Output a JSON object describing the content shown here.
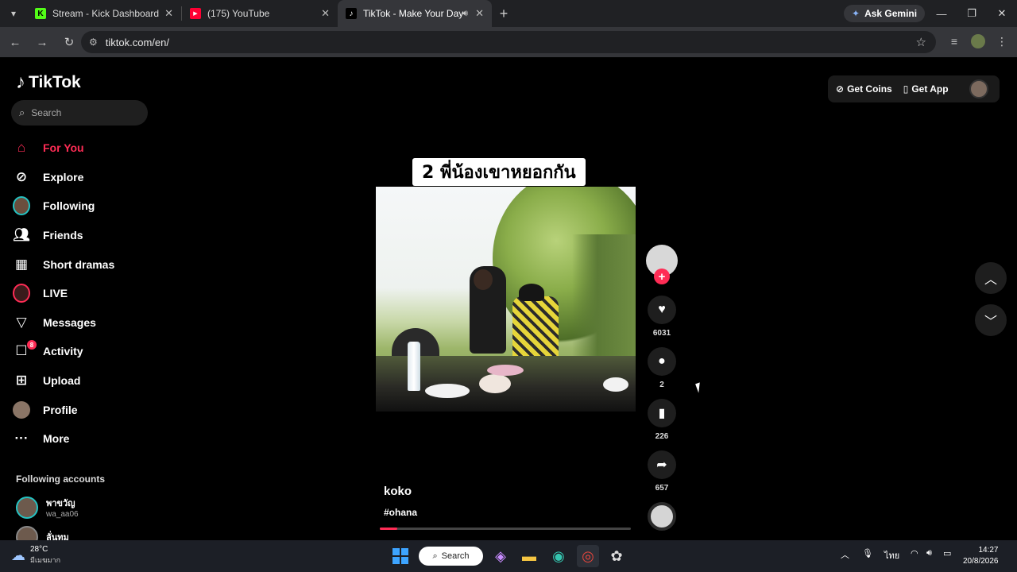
{
  "browser": {
    "tabs": [
      {
        "title": "Stream - Kick Dashboard",
        "favicon": "kick-icon",
        "color": "#53fc18"
      },
      {
        "title": "(175) YouTube",
        "favicon": "youtube-icon",
        "color": "#ff0033"
      },
      {
        "title": "TikTok - Make Your Day",
        "favicon": "tiktok-icon",
        "color": "#ffffff",
        "active": true
      }
    ],
    "ask_gemini": "Ask Gemini",
    "url": "tiktok.com/en/"
  },
  "tiktok": {
    "logo": "TikTok",
    "search_placeholder": "Search",
    "nav": [
      {
        "label": "For You",
        "icon": "home-icon",
        "active": true
      },
      {
        "label": "Explore",
        "icon": "compass-icon"
      },
      {
        "label": "Following",
        "icon": "following-avatar"
      },
      {
        "label": "Friends",
        "icon": "friends-icon"
      },
      {
        "label": "Short dramas",
        "icon": "film-icon"
      },
      {
        "label": "LIVE",
        "icon": "live-icon"
      },
      {
        "label": "Messages",
        "icon": "messages-icon"
      },
      {
        "label": "Activity",
        "icon": "activity-icon",
        "badge": "8"
      },
      {
        "label": "Upload",
        "icon": "upload-icon"
      },
      {
        "label": "Profile",
        "icon": "profile-avatar"
      },
      {
        "label": "More",
        "icon": "more-icon"
      }
    ],
    "following_accounts_title": "Following accounts",
    "following_accounts": [
      {
        "name": "พาขวัญ",
        "handle": "wa_aa06"
      },
      {
        "name": "ลั่นทม",
        "handle": ""
      }
    ],
    "top_right": {
      "get_coins": "Get Coins",
      "get_app": "Get App"
    },
    "video": {
      "caption": "2 พี่น้องเขาหยอกกัน",
      "author": "koko",
      "hashtag": "#ohana",
      "progress": 0.07
    },
    "actions": {
      "likes": "6031",
      "comments": "2",
      "saves": "226",
      "shares": "657"
    }
  },
  "taskbar": {
    "temperature": "28°C",
    "condition": "มีเมฆมาก",
    "search_label": "Search",
    "language": "ไทย",
    "time": "14:27",
    "date": "20/8/2026"
  },
  "colors": {
    "accent": "#fe2c55",
    "background": "#000000"
  }
}
